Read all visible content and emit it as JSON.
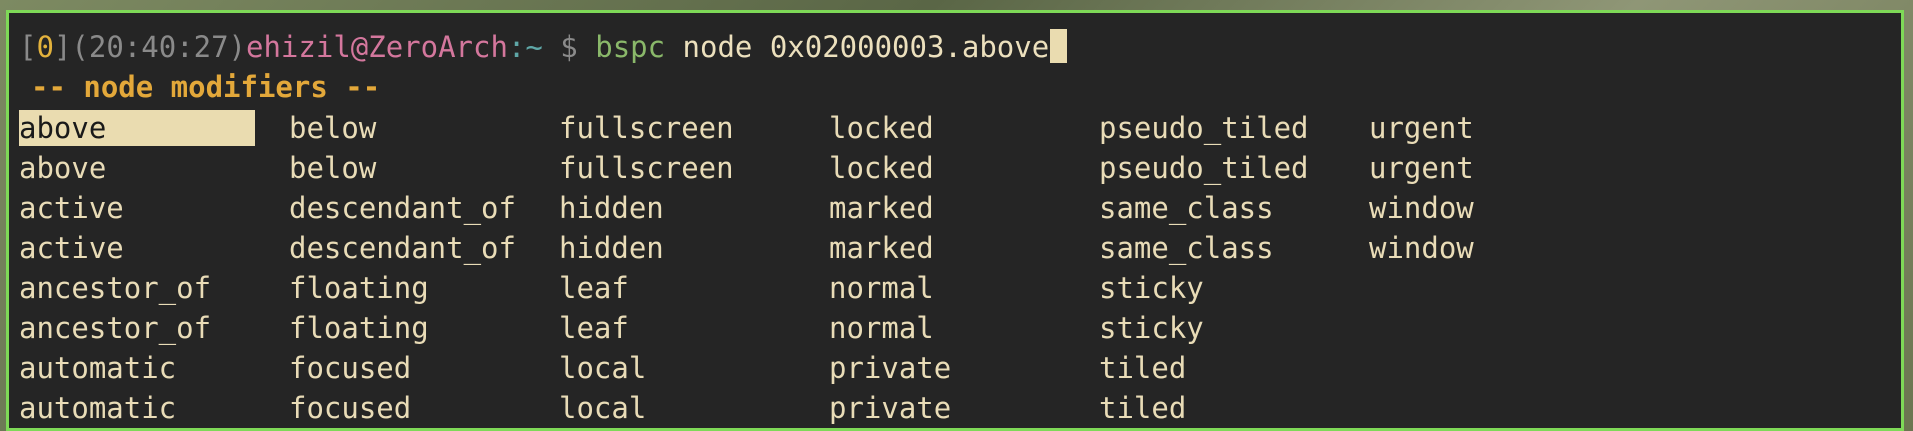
{
  "prompt": {
    "bracket_open": "[",
    "exit_code": "0",
    "bracket_close": "]",
    "time": "(20:40:27)",
    "user_host": "ehizil@ZeroArch",
    "path": ":~",
    "dollar": " $ ",
    "command": "bspc",
    "args": " node 0x02000003.above"
  },
  "completion": {
    "header": "-- node modifiers --",
    "rows": [
      [
        "above",
        "below",
        "fullscreen",
        "locked",
        "pseudo_tiled",
        "urgent"
      ],
      [
        "above",
        "below",
        "fullscreen",
        "locked",
        "pseudo_tiled",
        "urgent"
      ],
      [
        "active",
        "descendant_of",
        "hidden",
        "marked",
        "same_class",
        "window"
      ],
      [
        "active",
        "descendant_of",
        "hidden",
        "marked",
        "same_class",
        "window"
      ],
      [
        "ancestor_of",
        "floating",
        "leaf",
        "normal",
        "sticky",
        ""
      ],
      [
        "ancestor_of",
        "floating",
        "leaf",
        "normal",
        "sticky",
        ""
      ],
      [
        "automatic",
        "focused",
        "local",
        "private",
        "tiled",
        ""
      ],
      [
        "automatic",
        "focused",
        "local",
        "private",
        "tiled",
        ""
      ]
    ],
    "selected": "above"
  },
  "colors": {
    "border": "#7ed957",
    "background": "#252525",
    "selection": "#eadcb0",
    "header": "#e3a83a"
  }
}
